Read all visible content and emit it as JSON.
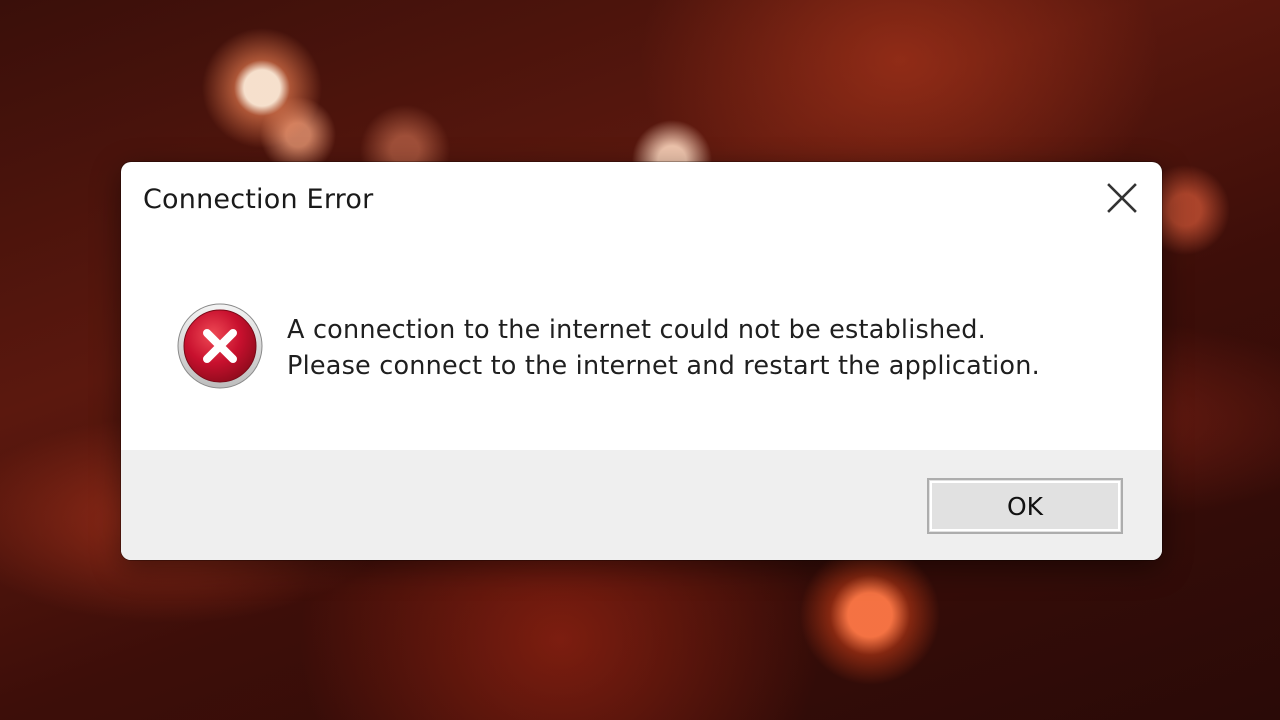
{
  "dialog": {
    "title": "Connection Error",
    "close_icon": "close-icon",
    "error_icon": "error-x-icon",
    "message_line1": "A connection to the internet could not be established.",
    "message_line2": "Please connect to the internet and restart the application.",
    "ok_label": "OK"
  },
  "colors": {
    "error_red": "#c8102e",
    "footer_bg": "#efefef",
    "button_bg": "#e1e1e1",
    "button_border": "#adadad"
  }
}
